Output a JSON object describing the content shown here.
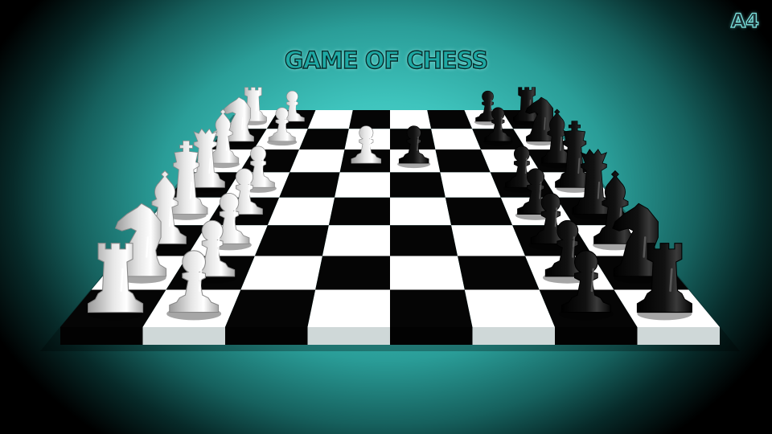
{
  "title": "GAME OF CHESS",
  "badge": "A4",
  "colors": {
    "background": "#3fc4bd",
    "light_square": "#ffffff",
    "dark_square": "#050505",
    "white_piece": "#e6e6e6",
    "black_piece": "#111111"
  },
  "board": {
    "files": 8,
    "ranks": 8
  },
  "pieces": [
    {
      "color": "white",
      "type": "rook",
      "file": 0,
      "rank": 0
    },
    {
      "color": "white",
      "type": "knight",
      "file": 1,
      "rank": 0
    },
    {
      "color": "white",
      "type": "bishop",
      "file": 2,
      "rank": 0
    },
    {
      "color": "white",
      "type": "king",
      "file": 3,
      "rank": 0
    },
    {
      "color": "white",
      "type": "queen",
      "file": 4,
      "rank": 0
    },
    {
      "color": "white",
      "type": "bishop",
      "file": 5,
      "rank": 0
    },
    {
      "color": "white",
      "type": "knight",
      "file": 6,
      "rank": 0
    },
    {
      "color": "white",
      "type": "rook",
      "file": 7,
      "rank": 0
    },
    {
      "color": "white",
      "type": "pawn",
      "file": 0,
      "rank": 1
    },
    {
      "color": "white",
      "type": "pawn",
      "file": 1,
      "rank": 1
    },
    {
      "color": "white",
      "type": "pawn",
      "file": 2,
      "rank": 1
    },
    {
      "color": "white",
      "type": "pawn",
      "file": 3,
      "rank": 1
    },
    {
      "color": "white",
      "type": "pawn",
      "file": 4,
      "rank": 1
    },
    {
      "color": "white",
      "type": "pawn",
      "file": 6,
      "rank": 1
    },
    {
      "color": "white",
      "type": "pawn",
      "file": 7,
      "rank": 1
    },
    {
      "color": "white",
      "type": "pawn",
      "file": 5,
      "rank": 3
    },
    {
      "color": "black",
      "type": "rook",
      "file": 0,
      "rank": 7
    },
    {
      "color": "black",
      "type": "knight",
      "file": 1,
      "rank": 7
    },
    {
      "color": "black",
      "type": "bishop",
      "file": 2,
      "rank": 7
    },
    {
      "color": "black",
      "type": "queen",
      "file": 3,
      "rank": 7
    },
    {
      "color": "black",
      "type": "king",
      "file": 4,
      "rank": 7
    },
    {
      "color": "black",
      "type": "bishop",
      "file": 5,
      "rank": 7
    },
    {
      "color": "black",
      "type": "knight",
      "file": 6,
      "rank": 7
    },
    {
      "color": "black",
      "type": "rook",
      "file": 7,
      "rank": 7
    },
    {
      "color": "black",
      "type": "pawn",
      "file": 0,
      "rank": 6
    },
    {
      "color": "black",
      "type": "pawn",
      "file": 1,
      "rank": 6
    },
    {
      "color": "black",
      "type": "pawn",
      "file": 2,
      "rank": 6
    },
    {
      "color": "black",
      "type": "pawn",
      "file": 3,
      "rank": 6
    },
    {
      "color": "black",
      "type": "pawn",
      "file": 4,
      "rank": 6
    },
    {
      "color": "black",
      "type": "pawn",
      "file": 6,
      "rank": 6
    },
    {
      "color": "black",
      "type": "pawn",
      "file": 7,
      "rank": 6
    },
    {
      "color": "black",
      "type": "pawn",
      "file": 5,
      "rank": 4
    }
  ]
}
